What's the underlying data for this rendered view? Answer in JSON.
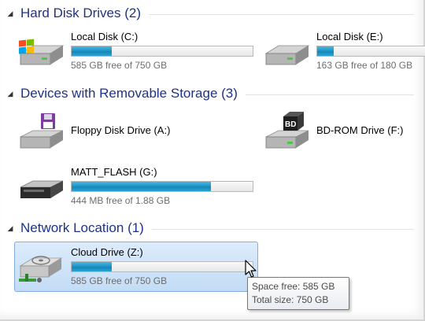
{
  "groups": {
    "hard_disk": {
      "toggle": "◢",
      "title": "Hard Disk Drives (2)"
    },
    "removable": {
      "toggle": "◢",
      "title": "Devices with Removable Storage (3)"
    },
    "network": {
      "toggle": "◢",
      "title": "Network Location (1)"
    }
  },
  "drives": {
    "c": {
      "name": "Local Disk (C:)",
      "free_text": "585 GB free of 750 GB",
      "used_fraction": 0.22
    },
    "e": {
      "name": "Local Disk (E:)",
      "free_text": "163 GB free of 180 GB",
      "used_fraction": 0.09
    },
    "floppy": {
      "name": "Floppy Disk Drive (A:)"
    },
    "bd": {
      "name": "BD-ROM Drive (F:)",
      "badge": "BD"
    },
    "flash": {
      "name": "MATT_FLASH (G:)",
      "free_text": "444 MB free of 1.88 GB",
      "used_fraction": 0.77
    },
    "cloud": {
      "name": "Cloud Drive (Z:)",
      "free_text": "585 GB free of 750 GB",
      "used_fraction": 0.22
    }
  },
  "tooltip": {
    "space_free": "Space free: 585 GB",
    "total_size": "Total size: 750 GB"
  },
  "colors": {
    "header": "#1e3287",
    "bar_fill": "#1f97c9",
    "selection": "#c3dcf5"
  }
}
